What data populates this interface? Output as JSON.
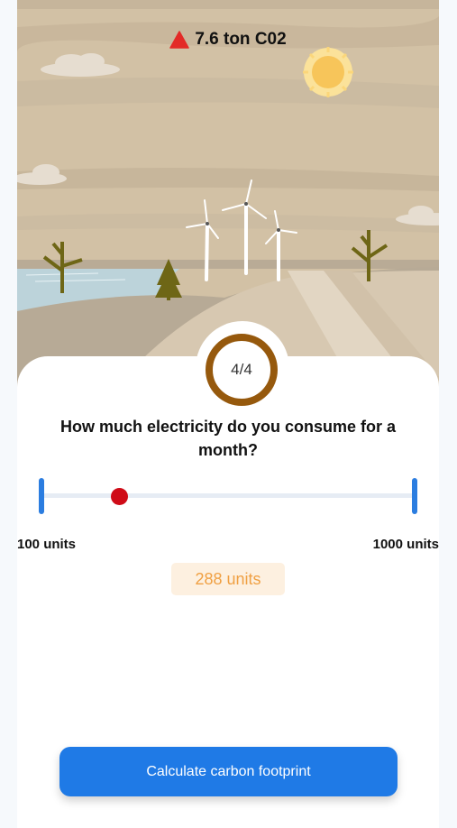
{
  "header": {
    "co2_label": "7.6 ton C02",
    "warning_icon": "triangle-up-red"
  },
  "progress": {
    "label": "4/4",
    "current": 4,
    "total": 4
  },
  "question": {
    "text": "How much electricity do you consume for a month?"
  },
  "slider": {
    "min": 100,
    "max": 1000,
    "value": 288,
    "min_label": "100 units",
    "max_label": "1000 units",
    "value_label": "288 units"
  },
  "action": {
    "button_label": "Calculate carbon footprint"
  },
  "colors": {
    "accent": "#1f7ae6",
    "thumb": "#cf0b17",
    "ring": "#96590d",
    "value_text": "#f0a043"
  }
}
